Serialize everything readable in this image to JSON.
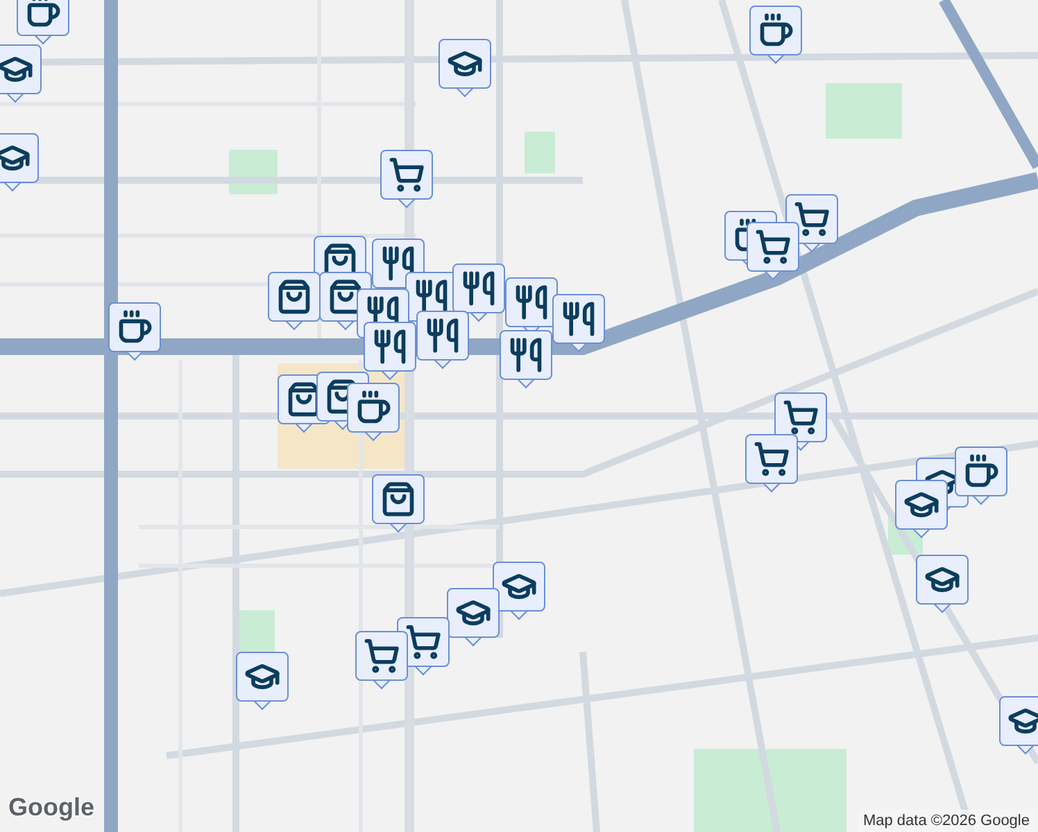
{
  "map": {
    "markers": [
      {
        "kind": "coffee"
      },
      {
        "kind": "school"
      },
      {
        "kind": "coffee"
      },
      {
        "kind": "school"
      },
      {
        "kind": "school"
      },
      {
        "kind": "cart"
      },
      {
        "kind": "coffee"
      },
      {
        "kind": "cart"
      },
      {
        "kind": "cart"
      },
      {
        "kind": "coffee"
      },
      {
        "kind": "bag"
      },
      {
        "kind": "restaurant"
      },
      {
        "kind": "bag"
      },
      {
        "kind": "bag"
      },
      {
        "kind": "restaurant"
      },
      {
        "kind": "restaurant"
      },
      {
        "kind": "restaurant"
      },
      {
        "kind": "restaurant"
      },
      {
        "kind": "restaurant"
      },
      {
        "kind": "restaurant"
      },
      {
        "kind": "restaurant"
      },
      {
        "kind": "restaurant"
      },
      {
        "kind": "bag"
      },
      {
        "kind": "bag"
      },
      {
        "kind": "coffee"
      },
      {
        "kind": "cart"
      },
      {
        "kind": "cart"
      },
      {
        "kind": "school"
      },
      {
        "kind": "coffee"
      },
      {
        "kind": "school"
      },
      {
        "kind": "school"
      },
      {
        "kind": "bag"
      },
      {
        "kind": "school"
      },
      {
        "kind": "school"
      },
      {
        "kind": "school"
      },
      {
        "kind": "cart"
      },
      {
        "kind": "cart"
      },
      {
        "kind": "school"
      }
    ]
  },
  "logo": "Google",
  "attribution": "Map data ©2026 Google"
}
